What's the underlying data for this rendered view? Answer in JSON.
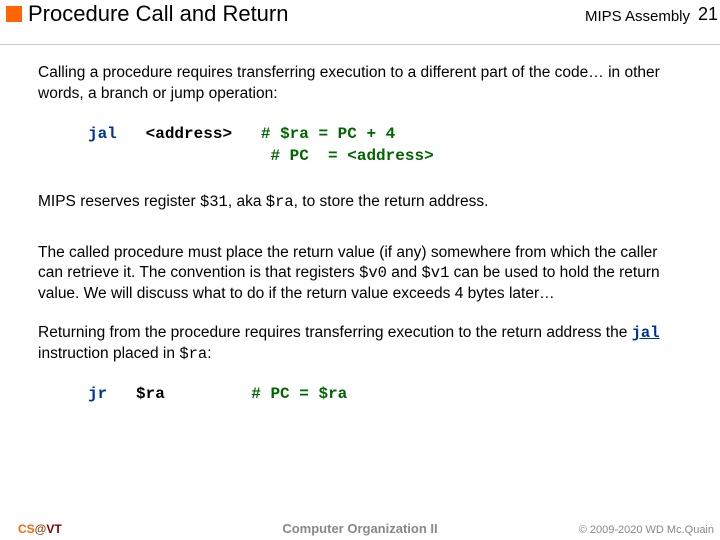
{
  "header": {
    "title": "Procedure Call and Return",
    "course": "MIPS Assembly",
    "page": "21"
  },
  "body": {
    "p1": "Calling a procedure requires transferring execution to a different part of the code… in other words, a branch or jump operation:",
    "code1": {
      "op": "jal",
      "arg": "<address>",
      "c1": "# $ra = PC + 4",
      "c2": "# PC  = <address>"
    },
    "p2a": "MIPS reserves register ",
    "p2b": ", aka ",
    "p2c": ", to store the return address.",
    "reg31": "$31",
    "ra": "$ra",
    "p3a": "The called procedure must place the return value (if any) somewhere from which the caller can retrieve it.  The convention is that registers ",
    "v0": "$v0",
    "p3b": " and ",
    "v1": "$v1",
    "p3c": " can be used to hold the return value.  We will discuss what to do if the return value exceeds 4 bytes later…",
    "p4a": "Returning from the procedure requires transferring execution to the return address the ",
    "jal": "jal",
    "p4b": " instruction placed in ",
    "p4c": ":",
    "code2": {
      "op": "jr",
      "arg": "$ra",
      "c1": "# PC = $ra"
    }
  },
  "footer": {
    "left_cs": "CS",
    "left_at": "@",
    "left_vt": "VT",
    "center": "Computer Organization II",
    "right": "© 2009-2020  WD Mc.Quain"
  }
}
